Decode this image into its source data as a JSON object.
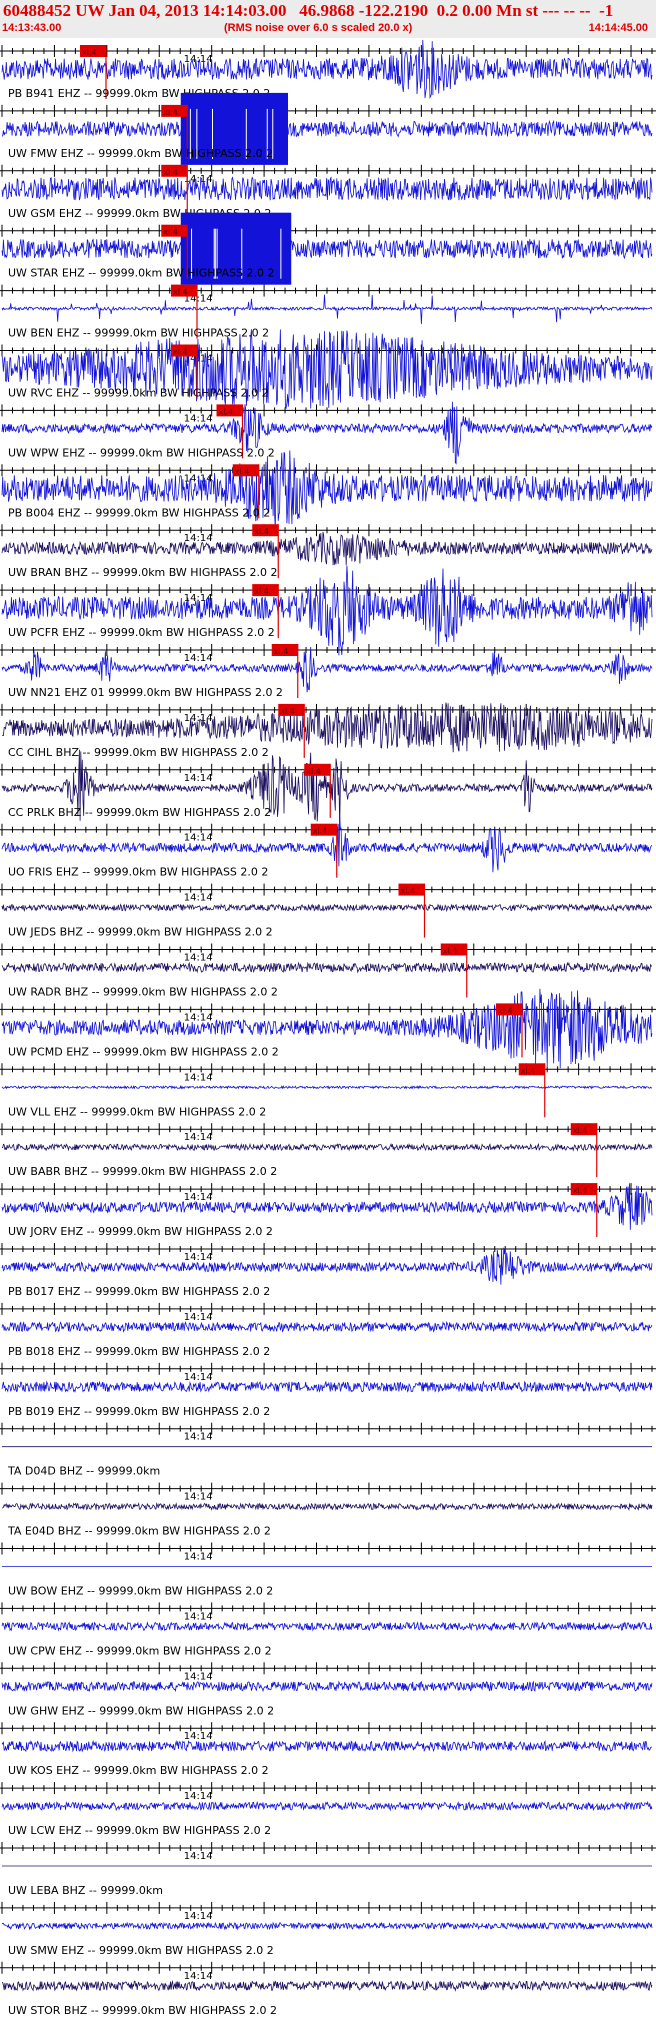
{
  "header": {
    "title": "60488452 UW Jan 04, 2013 14:14:03.00   46.9868 -122.2190  0.2 0.00 Mn st --- -- --  -1",
    "subtitle": "(RMS noise over 6.0 s scaled 20.0 x)",
    "start_time": "14:13:43.00",
    "end_time": "14:14:45.00"
  },
  "colors": {
    "blue": "#1212d8",
    "dark": "#1c1060",
    "pick": "#e00000",
    "axis": "#000000",
    "bg": "#ffffff"
  },
  "chart_data": {
    "type": "waveform",
    "time_range": [
      "14:13:43.00",
      "14:14:45.00"
    ],
    "time_mark_label": "14:14",
    "pick_label": "xl.4",
    "traces": [
      {
        "label": "PB B941 EHZ -- 99999.0km BW  HIGHPASS  2.0  2",
        "color": "#1212d8",
        "style": "noise",
        "amp": 0.28,
        "pick": 0.16,
        "events": [
          {
            "t": 0.65,
            "a": 0.5,
            "w": 0.05
          }
        ]
      },
      {
        "label": "UW FMW EHZ -- 99999.0km BW  HIGHPASS  2.0  2",
        "color": "#1212d8",
        "style": "block",
        "amp": 0.2,
        "pick": 0.285,
        "block": [
          0.275,
          0.44
        ]
      },
      {
        "label": "UW GSM EHZ -- 99999.0km BW  HIGHPASS  2.0  2",
        "color": "#1212d8",
        "style": "noise",
        "amp": 0.3,
        "pick": 0.285,
        "events": []
      },
      {
        "label": "UW STAR EHZ -- 99999.0km BW  HIGHPASS  2.0  2",
        "color": "#1212d8",
        "style": "block",
        "amp": 0.25,
        "pick": 0.285,
        "block": [
          0.275,
          0.445
        ]
      },
      {
        "label": "UW BEN EHZ -- 99999.0km BW  HIGHPASS  2.0  2",
        "color": "#1212d8",
        "style": "spiky",
        "amp": 0.04,
        "pick": 0.3,
        "events": []
      },
      {
        "label": "UW RVC EHZ -- 99999.0km BW  HIGHPASS  2.0  2",
        "color": "#1212d8",
        "style": "noise",
        "amp": 0.28,
        "pick": 0.3,
        "events": [
          {
            "t": 0.45,
            "a": 0.8,
            "w": 0.3
          }
        ]
      },
      {
        "label": "UW WPW EHZ -- 99999.0km BW  HIGHPASS  2.0  2",
        "color": "#1212d8",
        "style": "noise",
        "amp": 0.12,
        "pick": 0.37,
        "events": [
          {
            "t": 0.38,
            "a": 0.6,
            "w": 0.02
          },
          {
            "t": 0.7,
            "a": 0.9,
            "w": 0.015
          }
        ]
      },
      {
        "label": "PB B004 EHZ -- 99999.0km BW  HIGHPASS  2.0  2",
        "color": "#1212d8",
        "style": "noise",
        "amp": 0.35,
        "pick": 0.395,
        "events": [
          {
            "t": 0.42,
            "a": 0.75,
            "w": 0.06
          }
        ]
      },
      {
        "label": "UW BRAN BHZ -- 99999.0km BW  HIGHPASS  2.0  2",
        "color": "#1c1060",
        "style": "noise",
        "amp": 0.16,
        "pick": 0.425,
        "events": [
          {
            "t": 0.52,
            "a": 0.3,
            "w": 0.08
          }
        ]
      },
      {
        "label": "UW PCFR EHZ -- 99999.0km BW  HIGHPASS  2.0  2",
        "color": "#1212d8",
        "style": "noise",
        "amp": 0.3,
        "pick": 0.425,
        "events": [
          {
            "t": 0.52,
            "a": 1.0,
            "w": 0.04
          },
          {
            "t": 0.68,
            "a": 0.95,
            "w": 0.03
          },
          {
            "t": 0.97,
            "a": 0.6,
            "w": 0.02
          }
        ]
      },
      {
        "label": "UW NN21 EHZ 01 99999.0km BW  HIGHPASS  2.0  2",
        "color": "#1212d8",
        "style": "noise",
        "amp": 0.1,
        "pick": 0.455,
        "events": [
          {
            "t": 0.05,
            "a": 0.4,
            "w": 0.01
          },
          {
            "t": 0.16,
            "a": 0.4,
            "w": 0.01
          },
          {
            "t": 0.47,
            "a": 0.6,
            "w": 0.01
          },
          {
            "t": 0.76,
            "a": 0.4,
            "w": 0.01
          },
          {
            "t": 0.95,
            "a": 0.5,
            "w": 0.01
          }
        ]
      },
      {
        "label": "CC CIHL BHZ -- 99999.0km BW  HIGHPASS  2.0  2",
        "color": "#1c1060",
        "style": "noise",
        "amp": 0.22,
        "pick": 0.465,
        "events": [
          {
            "t": 0.7,
            "a": 0.45,
            "w": 0.3
          }
        ]
      },
      {
        "label": "CC PRLK BHZ -- 99999.0km BW  HIGHPASS  2.0  2",
        "color": "#1c1060",
        "style": "noise",
        "amp": 0.1,
        "pick": 0.505,
        "events": [
          {
            "t": 0.12,
            "a": 1.0,
            "w": 0.015
          },
          {
            "t": 0.42,
            "a": 0.8,
            "w": 0.03
          },
          {
            "t": 0.48,
            "a": 0.9,
            "w": 0.015
          },
          {
            "t": 0.52,
            "a": 1.0,
            "w": 0.01
          },
          {
            "t": 0.81,
            "a": 0.9,
            "w": 0.008
          }
        ]
      },
      {
        "label": "UO FRIS EHZ -- 99999.0km BW  HIGHPASS  2.0  2",
        "color": "#1212d8",
        "style": "noise",
        "amp": 0.12,
        "pick": 0.515,
        "events": [
          {
            "t": 0.52,
            "a": 0.7,
            "w": 0.01
          },
          {
            "t": 0.76,
            "a": 0.6,
            "w": 0.015
          }
        ]
      },
      {
        "label": "UW JEDS BHZ -- 99999.0km BW  HIGHPASS  2.0  2",
        "color": "#1c1060",
        "style": "noise",
        "amp": 0.08,
        "pick": 0.65,
        "events": []
      },
      {
        "label": "UW RADR BHZ -- 99999.0km BW  HIGHPASS  2.0  2",
        "color": "#1c1060",
        "style": "noise",
        "amp": 0.12,
        "pick": 0.715,
        "events": []
      },
      {
        "label": "UW PCMD EHZ -- 99999.0km BW  HIGHPASS  2.0  2",
        "color": "#1212d8",
        "style": "noise",
        "amp": 0.2,
        "pick": 0.8,
        "events": [
          {
            "t": 0.85,
            "a": 0.9,
            "w": 0.12
          }
        ]
      },
      {
        "label": "UW VLL EHZ -- 99999.0km BW  HIGHPASS  2.0  2",
        "color": "#1212d8",
        "style": "noise",
        "amp": 0.03,
        "pick": 0.835,
        "events": []
      },
      {
        "label": "UW BABR BHZ -- 99999.0km BW  HIGHPASS  2.0  2",
        "color": "#1c1060",
        "style": "noise",
        "amp": 0.08,
        "pick": 0.915,
        "events": []
      },
      {
        "label": "UW JORV EHZ -- 99999.0km BW  HIGHPASS  2.0  2",
        "color": "#1212d8",
        "style": "noise",
        "amp": 0.14,
        "pick": 0.915,
        "events": [
          {
            "t": 0.97,
            "a": 0.5,
            "w": 0.03
          }
        ]
      },
      {
        "label": "PB B017 EHZ -- 99999.0km BW  HIGHPASS  2.0  2",
        "color": "#1212d8",
        "style": "noise",
        "amp": 0.12,
        "events": [
          {
            "t": 0.77,
            "a": 0.4,
            "w": 0.03
          }
        ]
      },
      {
        "label": "PB B018 EHZ -- 99999.0km BW  HIGHPASS  2.0  2",
        "color": "#1212d8",
        "style": "noise",
        "amp": 0.12,
        "events": []
      },
      {
        "label": "PB B019 EHZ -- 99999.0km BW  HIGHPASS  2.0  2",
        "color": "#1212d8",
        "style": "noise",
        "amp": 0.13,
        "events": []
      },
      {
        "label": "TA D04D BHZ -- 99999.0km",
        "color": "#1c1060",
        "style": "flat",
        "amp": 0,
        "events": []
      },
      {
        "label": "TA E04D BHZ -- 99999.0km BW  HIGHPASS  2.0  2",
        "color": "#1c1060",
        "style": "noise",
        "amp": 0.08,
        "events": []
      },
      {
        "label": "UW BOW EHZ -- 99999.0km BW  HIGHPASS  2.0  2",
        "color": "#1212d8",
        "style": "flat",
        "amp": 0,
        "events": []
      },
      {
        "label": "UW CPW EHZ -- 99999.0km BW  HIGHPASS  2.0  2",
        "color": "#1212d8",
        "style": "noise",
        "amp": 0.1,
        "events": []
      },
      {
        "label": "UW GHW EHZ -- 99999.0km BW  HIGHPASS  2.0  2",
        "color": "#1212d8",
        "style": "noise",
        "amp": 0.12,
        "events": []
      },
      {
        "label": "UW KOS EHZ -- 99999.0km BW  HIGHPASS  2.0  2",
        "color": "#1212d8",
        "style": "noise",
        "amp": 0.13,
        "events": []
      },
      {
        "label": "UW LCW EHZ -- 99999.0km BW  HIGHPASS  2.0  2",
        "color": "#1212d8",
        "style": "noise",
        "amp": 0.1,
        "events": []
      },
      {
        "label": "UW LEBA BHZ -- 99999.0km",
        "color": "#1c1060",
        "style": "flat",
        "amp": 0,
        "events": []
      },
      {
        "label": "UW SMW EHZ -- 99999.0km BW  HIGHPASS  2.0  2",
        "color": "#1212d8",
        "style": "noise",
        "amp": 0.08,
        "events": []
      },
      {
        "label": "UW STOR BHZ -- 99999.0km BW  HIGHPASS  2.0  2",
        "color": "#1c1060",
        "style": "noise",
        "amp": 0.12,
        "events": []
      }
    ]
  }
}
